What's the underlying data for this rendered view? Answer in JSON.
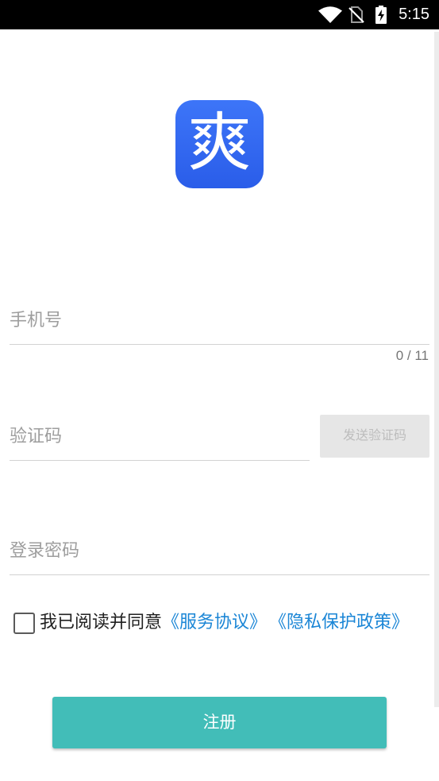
{
  "status_bar": {
    "time": "5:15",
    "icons": {
      "wifi": "wifi-icon",
      "sim": "no-sim-icon",
      "battery": "battery-charging-icon"
    }
  },
  "app": {
    "logo_glyph": "爽",
    "logo_color": "#2f63f0"
  },
  "form": {
    "phone": {
      "placeholder": "手机号",
      "value": "",
      "counter": "0 / 11"
    },
    "code": {
      "placeholder": "验证码",
      "value": "",
      "send_button_label": "发送验证码"
    },
    "password": {
      "placeholder": "登录密码",
      "value": ""
    }
  },
  "agreement": {
    "checked": false,
    "prefix": "我已阅读并同意",
    "terms_link": "《服务协议》",
    "privacy_link": "《隐私保护政策》"
  },
  "register_button": {
    "label": "注册"
  },
  "colors": {
    "status_bar": "#000000",
    "logo_blue": "#2f63f0",
    "link_blue": "#1b86d6",
    "primary_button": "#42bdb8",
    "placeholder": "#9e9e9e",
    "disabled_button_bg": "#e6e6e6",
    "disabled_button_text": "#bdbdbd"
  }
}
